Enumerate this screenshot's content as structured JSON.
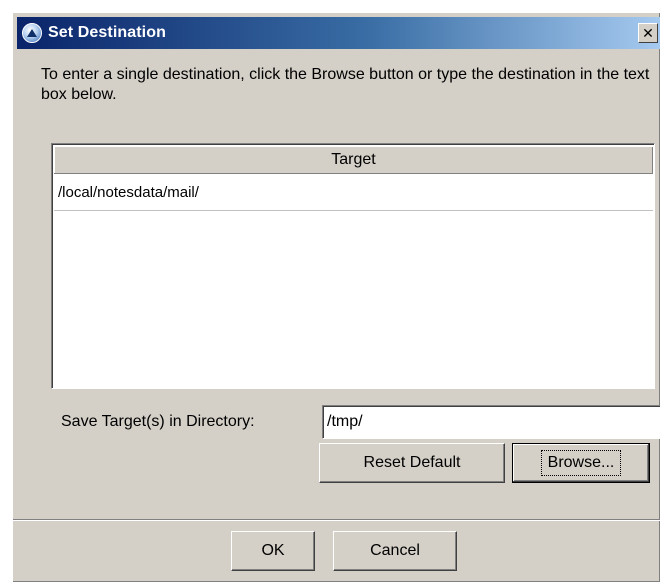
{
  "window": {
    "title": "Set Destination",
    "close_glyph": "✕"
  },
  "instruction": "To enter a single destination, click the Browse button or type the destination in the text box below.",
  "table": {
    "column_header": "Target",
    "rows": [
      "/local/notesdata/mail/"
    ]
  },
  "directory": {
    "label": "Save Target(s) in Directory:",
    "value": "/tmp/"
  },
  "buttons": {
    "reset_default": "Reset Default",
    "browse": "Browse...",
    "ok": "OK",
    "cancel": "Cancel"
  },
  "icons": {
    "app": "notes-app-icon",
    "close": "close-icon"
  }
}
